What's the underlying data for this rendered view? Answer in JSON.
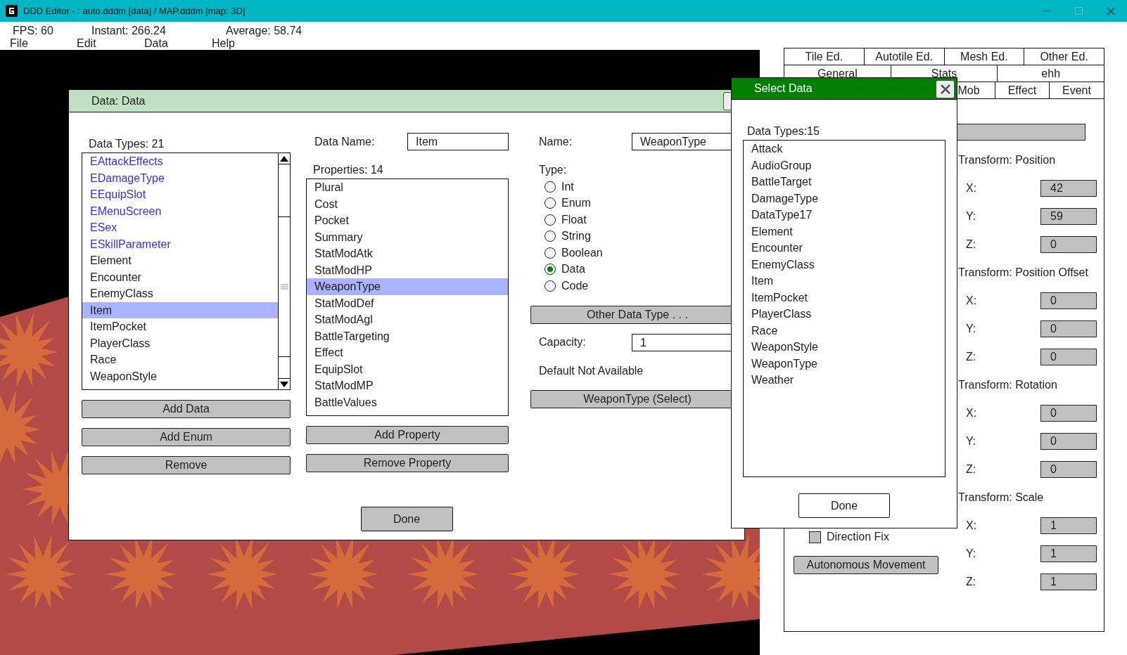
{
  "window": {
    "title": "DDD Editor - : auto.dddm [data] / MAP.dddm [map: 3D]"
  },
  "stats": [
    "FPS: 60",
    "Instant: 266.24",
    "Average: 58.74"
  ],
  "menu": [
    "File",
    "Edit",
    "Data",
    "Help"
  ],
  "editor_tabs": [
    "Tile Ed.",
    "Autotile Ed.",
    "Mesh Ed.",
    "Other Ed."
  ],
  "section_tabs": [
    "General",
    "Stats",
    "ehh"
  ],
  "sub_tabs": [
    "Mob",
    "Effect",
    "Event"
  ],
  "transform": [
    {
      "title": "Transform: Position",
      "axes": [
        {
          "label": "X:",
          "value": "42"
        },
        {
          "label": "Y:",
          "value": "59"
        },
        {
          "label": "Z:",
          "value": "0"
        }
      ]
    },
    {
      "title": "Transform: Position Offset",
      "axes": [
        {
          "label": "X:",
          "value": "0"
        },
        {
          "label": "Y:",
          "value": "0"
        },
        {
          "label": "Z:",
          "value": "0"
        }
      ]
    },
    {
      "title": "Transform: Rotation",
      "axes": [
        {
          "label": "X:",
          "value": "0"
        },
        {
          "label": "Y:",
          "value": "0"
        },
        {
          "label": "Z:",
          "value": "0"
        }
      ]
    },
    {
      "title": "Transform: Scale",
      "axes": [
        {
          "label": "X:",
          "value": "1"
        },
        {
          "label": "Y:",
          "value": "1"
        },
        {
          "label": "Z:",
          "value": "1"
        }
      ]
    }
  ],
  "direction_fix": {
    "label": "Direction Fix",
    "checked": false
  },
  "autonomous_button": "Autonomous Movement",
  "data_dialog": {
    "title": "Data: Data",
    "types_label": "Data Types: 21",
    "types": [
      {
        "label": "EAttackEffects",
        "kind": "enum",
        "selected": false
      },
      {
        "label": "EDamageType",
        "kind": "enum",
        "selected": false
      },
      {
        "label": "EEquipSlot",
        "kind": "enum",
        "selected": false
      },
      {
        "label": "EMenuScreen",
        "kind": "enum",
        "selected": false
      },
      {
        "label": "ESex",
        "kind": "enum",
        "selected": false
      },
      {
        "label": "ESkillParameter",
        "kind": "enum",
        "selected": false
      },
      {
        "label": "Element",
        "kind": "data",
        "selected": false
      },
      {
        "label": "Encounter",
        "kind": "data",
        "selected": false
      },
      {
        "label": "EnemyClass",
        "kind": "data",
        "selected": false
      },
      {
        "label": "Item",
        "kind": "data",
        "selected": true
      },
      {
        "label": "ItemPocket",
        "kind": "data",
        "selected": false
      },
      {
        "label": "PlayerClass",
        "kind": "data",
        "selected": false
      },
      {
        "label": "Race",
        "kind": "data",
        "selected": false
      },
      {
        "label": "WeaponStyle",
        "kind": "data",
        "selected": false
      }
    ],
    "type_buttons": [
      "Add Data",
      "Add Enum",
      "Remove"
    ],
    "data_name_label": "Data Name:",
    "data_name": "Item",
    "properties_label": "Properties: 14",
    "properties": [
      {
        "label": "Plural",
        "selected": false
      },
      {
        "label": "Cost",
        "selected": false
      },
      {
        "label": "Pocket",
        "selected": false
      },
      {
        "label": "Summary",
        "selected": false
      },
      {
        "label": "StatModAtk",
        "selected": false
      },
      {
        "label": "StatModHP",
        "selected": false
      },
      {
        "label": "WeaponType",
        "selected": true
      },
      {
        "label": "StatModDef",
        "selected": false
      },
      {
        "label": "StatModAgl",
        "selected": false
      },
      {
        "label": "BattleTargeting",
        "selected": false
      },
      {
        "label": "Effect",
        "selected": false
      },
      {
        "label": "EquipSlot",
        "selected": false
      },
      {
        "label": "StatModMP",
        "selected": false
      },
      {
        "label": "BattleValues",
        "selected": false
      }
    ],
    "property_buttons": [
      "Add Property",
      "Remove Property"
    ],
    "name_label": "Name:",
    "name": "WeaponType",
    "type_label": "Type:",
    "value_types": [
      {
        "label": "Int",
        "selected": false
      },
      {
        "label": "Enum",
        "selected": false
      },
      {
        "label": "Float",
        "selected": false
      },
      {
        "label": "String",
        "selected": false
      },
      {
        "label": "Boolean",
        "selected": false
      },
      {
        "label": "Data",
        "selected": true
      },
      {
        "label": "Code",
        "selected": false
      }
    ],
    "other_type_button": "Other Data Type . . .",
    "capacity_label": "Capacity:",
    "capacity": "1",
    "default_note": "Default Not Available",
    "select_button": "WeaponType (Select)",
    "done_button": "Done"
  },
  "select_dialog": {
    "title": "Select Data",
    "count_label": "Data Types:15",
    "items": [
      {
        "label": "Attack",
        "selected": false
      },
      {
        "label": "AudioGroup",
        "selected": false
      },
      {
        "label": "BattleTarget",
        "selected": false
      },
      {
        "label": "DamageType",
        "selected": false
      },
      {
        "label": "DataType17",
        "selected": false
      },
      {
        "label": "Element",
        "selected": false
      },
      {
        "label": "Encounter",
        "selected": false
      },
      {
        "label": "EnemyClass",
        "selected": false
      },
      {
        "label": "Item",
        "selected": false
      },
      {
        "label": "ItemPocket",
        "selected": false
      },
      {
        "label": "PlayerClass",
        "selected": false
      },
      {
        "label": "Race",
        "selected": false
      },
      {
        "label": "WeaponStyle",
        "selected": false
      },
      {
        "label": "WeaponType",
        "selected": false
      },
      {
        "label": "Weather",
        "selected": false
      }
    ],
    "done_button": "Done"
  }
}
